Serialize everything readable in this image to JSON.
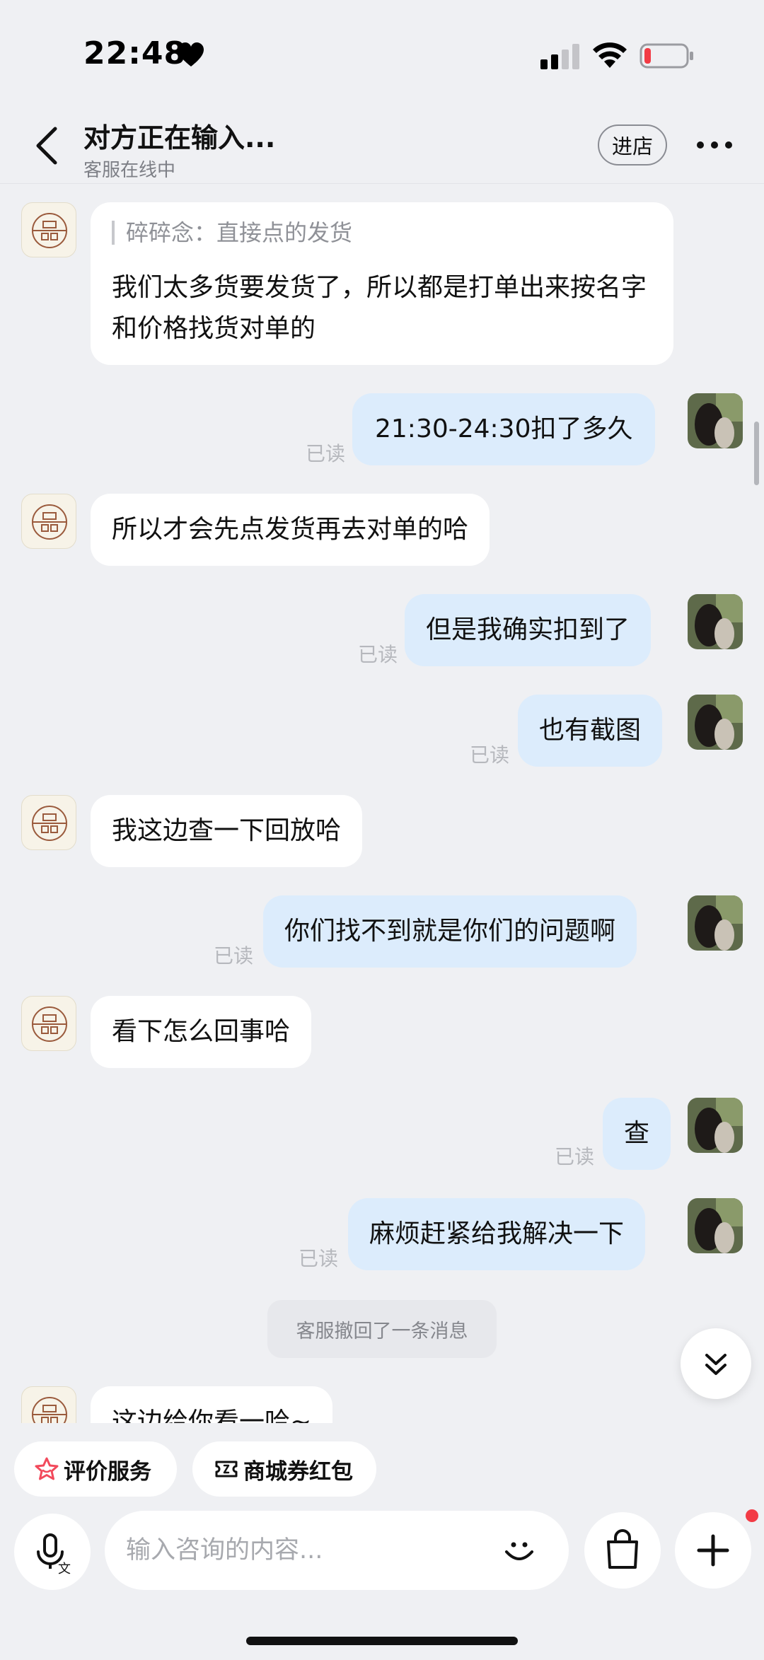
{
  "status_bar": {
    "time": "22:48"
  },
  "header": {
    "title": "对方正在输入...",
    "subtitle": "客服在线中",
    "enter_store_label": "进店"
  },
  "messages": {
    "quote": {
      "prefix": "碎碎念：直接点的发货",
      "reply": "我们太多货要发货了，所以都是打单出来按名字和价格找货对单的"
    },
    "m1": "21:30-24:30扣了多久",
    "m2": "所以才会先点发货再去对单的哈",
    "m3": "但是我确实扣到了",
    "m4": "也有截图",
    "m5": "我这边查一下回放哈",
    "m6": "你们找不到就是你们的问题啊",
    "m7": "看下怎么回事哈",
    "m8": "查",
    "m9": "麻烦赶紧给我解决一下",
    "m10": "这边给你看一哈~",
    "read_label": "已读",
    "system_notice": "客服撤回了一条消息"
  },
  "quick_actions": {
    "rating_label": "评价服务",
    "coupon_label": "商城券红包"
  },
  "composer": {
    "placeholder": "输入咨询的内容..."
  },
  "colors": {
    "background": "#eff0f3",
    "outgoing_bubble": "#dcecfc",
    "incoming_bubble": "#ffffff",
    "battery_low": "#f23b45",
    "rating_icon": "#f24a5c"
  },
  "icons": [
    "heart-icon",
    "signal-icon",
    "wifi-icon",
    "battery-icon",
    "back-arrow-icon",
    "more-icon",
    "shop-logo-icon",
    "double-chevron-down-icon",
    "star-icon",
    "coupon-icon",
    "voice-translate-icon",
    "emoji-icon",
    "shopping-bag-icon",
    "plus-icon"
  ]
}
